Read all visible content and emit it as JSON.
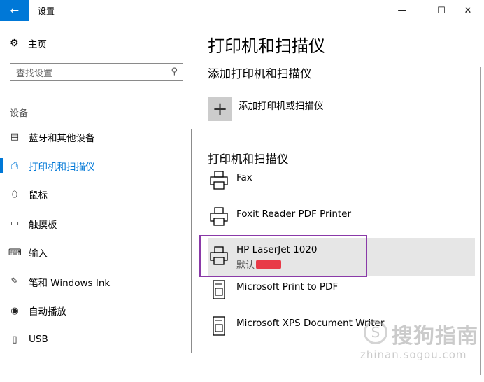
{
  "window": {
    "title": "设置",
    "back_icon": "←",
    "minimize_icon": "—",
    "maximize_icon": "☐",
    "close_icon": "✕"
  },
  "sidebar": {
    "home_icon": "⚙",
    "home_label": "主页",
    "search": {
      "placeholder": "查找设置",
      "icon": "⚲"
    },
    "section_label": "设备",
    "items": [
      {
        "icon": "▤",
        "label": "蓝牙和其他设备",
        "active": false
      },
      {
        "icon": "⎙",
        "label": "打印机和扫描仪",
        "active": true
      },
      {
        "icon": "⬯",
        "label": "鼠标",
        "active": false
      },
      {
        "icon": "▭",
        "label": "触摸板",
        "active": false
      },
      {
        "icon": "⌨",
        "label": "输入",
        "active": false
      },
      {
        "icon": "✎",
        "label": "笔和 Windows Ink",
        "active": false
      },
      {
        "icon": "◉",
        "label": "自动播放",
        "active": false
      },
      {
        "icon": "▯",
        "label": "USB",
        "active": false
      }
    ]
  },
  "main": {
    "title": "打印机和扫描仪",
    "add_section_title": "添加打印机和扫描仪",
    "add_button_icon": "+",
    "add_label": "添加打印机或扫描仪",
    "list_title": "打印机和扫描仪",
    "printers": [
      {
        "name": "Fax",
        "status": "",
        "icon": "printer-icon"
      },
      {
        "name": "Foxit Reader PDF Printer",
        "status": "",
        "icon": "printer-icon"
      },
      {
        "name": "HP LaserJet 1020",
        "status": "默认",
        "icon": "printer-icon",
        "selected": true
      },
      {
        "name": "Microsoft Print to PDF",
        "status": "",
        "icon": "document-printer-icon"
      },
      {
        "name": "Microsoft XPS Document Writer",
        "status": "",
        "icon": "document-printer-icon"
      }
    ]
  },
  "watermark": {
    "text": "搜狗指南",
    "sub": "zhinan.sogou.com"
  }
}
